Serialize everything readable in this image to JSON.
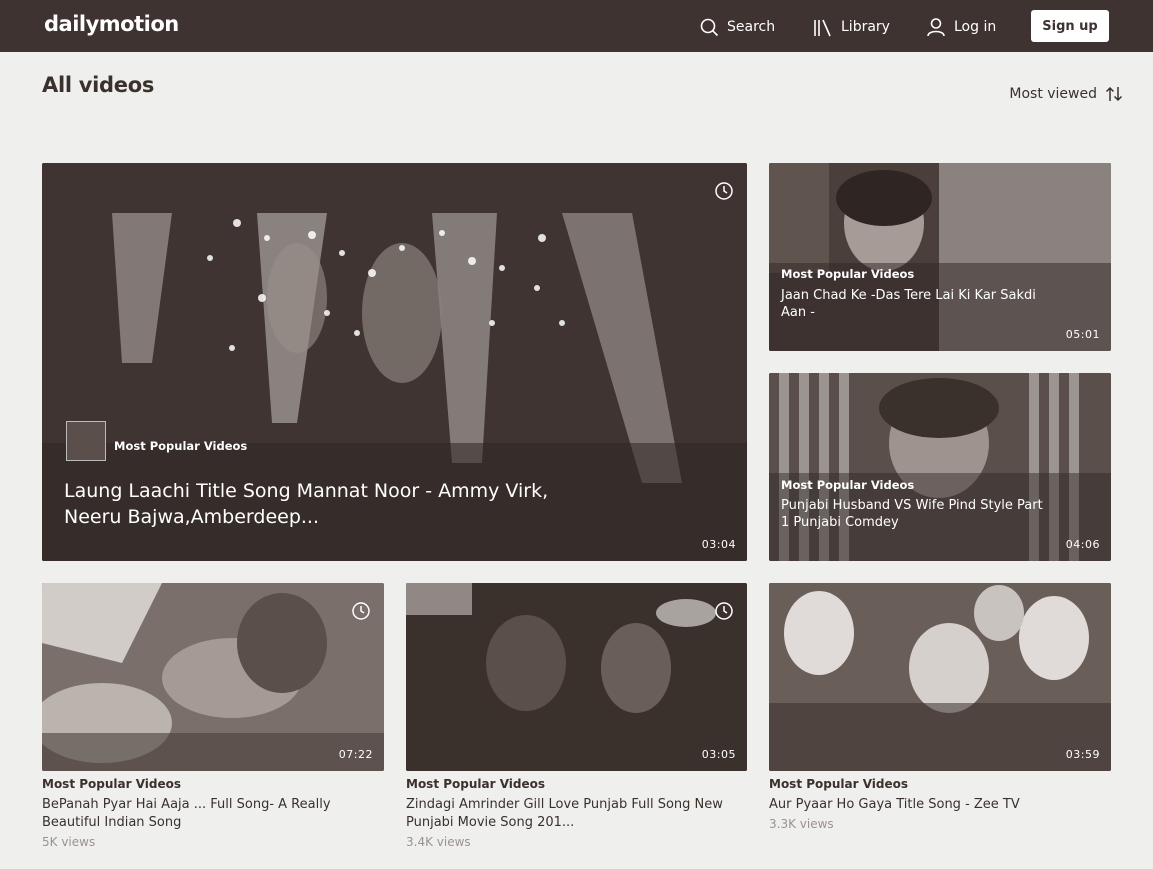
{
  "header": {
    "logo": "dailymotion",
    "search_label": "Search",
    "library_label": "Library",
    "login_label": "Log in",
    "signup_label": "Sign up"
  },
  "page": {
    "title": "All videos",
    "sort_label": "Most viewed"
  },
  "featured": {
    "channel": "Most Popular Videos",
    "title": "Laung Laachi Title Song Mannat Noor - Ammy Virk, Neeru Bajwa,Amberdeep...",
    "duration": "03:04"
  },
  "side_videos": [
    {
      "channel": "Most Popular Videos",
      "title": "Jaan Chad Ke -Das Tere Lai Ki Kar Sakdi Aan -",
      "duration": "05:01"
    },
    {
      "channel": "Most Popular Videos",
      "title": "Punjabi Husband VS Wife Pind Style Part 1 Punjabi Comdey",
      "duration": "04:06"
    }
  ],
  "grid_videos": [
    {
      "channel": "Most Popular Videos",
      "title": "BePanah Pyar Hai Aaja ... Full Song- A Really Beautiful Indian Song",
      "views": "5K views",
      "duration": "07:22"
    },
    {
      "channel": "Most Popular Videos",
      "title": "Zindagi Amrinder Gill Love Punjab Full Song New Punjabi Movie Song 201...",
      "views": "3.4K views",
      "duration": "03:05"
    },
    {
      "channel": "Most Popular Videos",
      "title": "Aur Pyaar Ho Gaya Title Song - Zee TV",
      "views": "3.3K views",
      "duration": "03:59"
    }
  ]
}
